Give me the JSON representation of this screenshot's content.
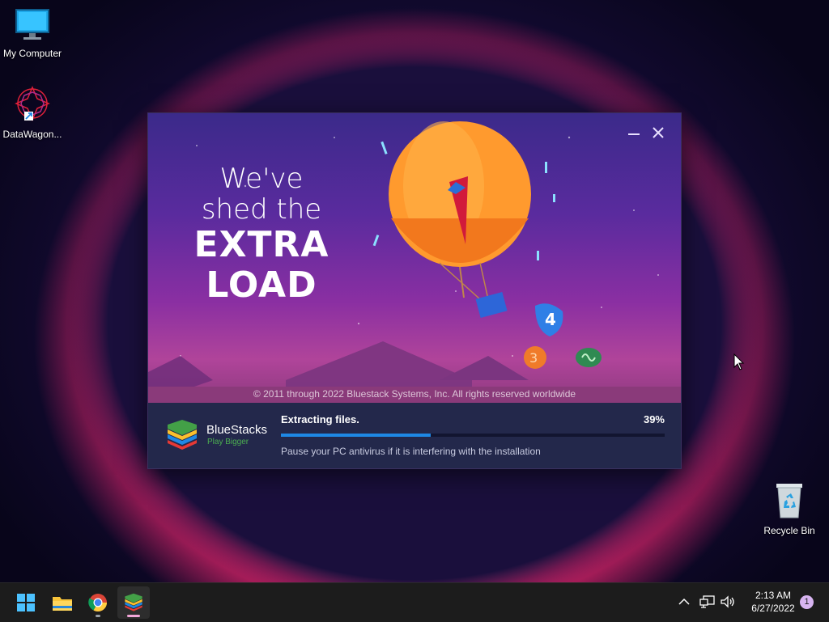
{
  "desktop": {
    "icons": [
      {
        "label": "My Computer",
        "icon": "monitor-icon"
      },
      {
        "label": "DataWagon...",
        "icon": "datawagon-icon"
      },
      {
        "label": "Recycle Bin",
        "icon": "recycle-bin-icon"
      }
    ]
  },
  "installer": {
    "headline_line1": "We've",
    "headline_line2": "shed the",
    "headline_line3": "EXTRA",
    "headline_line4": "LOAD",
    "balloon_numbers": [
      "4",
      "3"
    ],
    "copyright": "© 2011 through 2022 Bluestack Systems, Inc. All rights reserved worldwide",
    "brand_name": "BlueStacks",
    "brand_sub": "Play Bigger",
    "status": "Extracting files.",
    "percent_label": "39%",
    "progress": 0.39,
    "hint": "Pause your PC antivirus if it is interfering with the installation",
    "minimize_icon": "minimize-icon",
    "close_icon": "close-icon"
  },
  "taskbar": {
    "apps": [
      "start-icon",
      "file-explorer-icon",
      "chrome-icon",
      "bluestacks-icon"
    ],
    "time": "2:13 AM",
    "date": "6/27/2022",
    "notification_count": "1",
    "accent": "#1e88e5"
  }
}
